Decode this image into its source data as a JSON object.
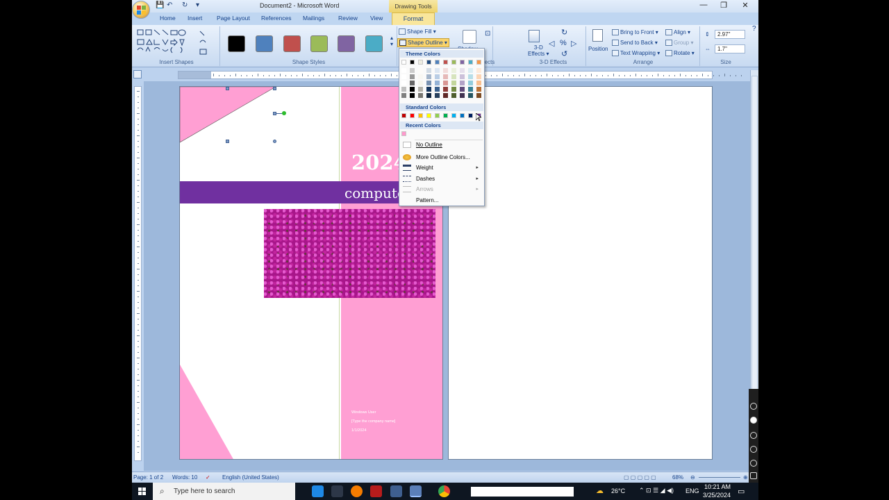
{
  "window": {
    "title": "Document2 - Microsoft Word",
    "context_tab_group": "Drawing Tools",
    "controls": {
      "minimize": "—",
      "maximize": "❐",
      "close": "✕"
    }
  },
  "tabs": [
    {
      "label": "Home"
    },
    {
      "label": "Insert"
    },
    {
      "label": "Page Layout"
    },
    {
      "label": "References"
    },
    {
      "label": "Mailings"
    },
    {
      "label": "Review"
    },
    {
      "label": "View"
    },
    {
      "label": "Format"
    }
  ],
  "ribbon": {
    "insert_shapes_label": "Insert Shapes",
    "shape_styles_label": "Shape Styles",
    "style_swatches": [
      "#000000",
      "#4f81bd",
      "#c0504d",
      "#9bbb59",
      "#8064a2",
      "#4bacc6"
    ],
    "shape_fill": "Shape Fill",
    "shape_outline": "Shape Outline",
    "shadow_label": "Shadow",
    "shadow_effects_label": "w Effects",
    "effects_3d": "3-D Effects",
    "effects_3d_btn": "3-D",
    "effects_3d_btn2": "Effects",
    "effects_3d_group": "3-D Effects",
    "position": "Position",
    "bring_to_front": "Bring to Front",
    "send_to_back": "Send to Back",
    "text_wrapping": "Text Wrapping",
    "align": "Align",
    "group": "Group",
    "rotate": "Rotate",
    "arrange_label": "Arrange",
    "height": "2.97\"",
    "width": "1.7\"",
    "size_label": "Size"
  },
  "document": {
    "year": "2024",
    "band_text": "compute",
    "author": "Windows User",
    "company": "[Type the company name]",
    "date": "1/1/2024"
  },
  "dropdown": {
    "theme_colors_label": "Theme Colors",
    "theme_top": [
      "#ffffff",
      "#000000",
      "#eeece1",
      "#1f497d",
      "#4f81bd",
      "#c0504d",
      "#9bbb59",
      "#8064a2",
      "#4bacc6",
      "#f79646"
    ],
    "standard_colors_label": "Standard Colors",
    "standard": [
      "#c00000",
      "#ff0000",
      "#ffc000",
      "#ffff00",
      "#92d050",
      "#00b050",
      "#00b0f0",
      "#0070c0",
      "#002060",
      "#7030a0"
    ],
    "recent_colors_label": "Recent Colors",
    "recent": [
      "#ff99cc"
    ],
    "items": {
      "no_outline": "No Outline",
      "more_colors": "More Outline Colors...",
      "weight": "Weight",
      "dashes": "Dashes",
      "arrows": "Arrows",
      "pattern": "Pattern..."
    }
  },
  "status": {
    "page": "Page: 1 of 2",
    "words": "Words: 10",
    "language": "English (United States)",
    "zoom": "68%"
  },
  "taskbar": {
    "search_placeholder": "Type here to search",
    "temperature": "26°C",
    "language": "ENG",
    "time": "10:21 AM",
    "date": "3/25/2024"
  }
}
